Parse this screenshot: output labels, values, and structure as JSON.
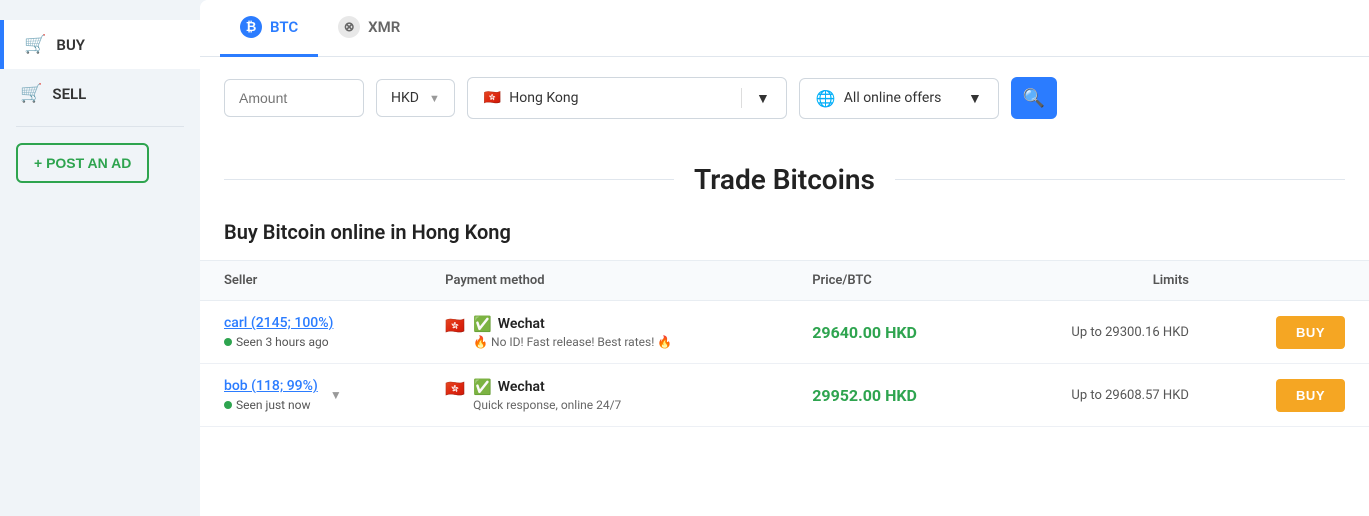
{
  "sidebar": {
    "items": [
      {
        "id": "buy",
        "label": "BUY",
        "icon": "🛒",
        "active": true
      },
      {
        "id": "sell",
        "label": "SELL",
        "icon": "🛒",
        "active": false
      }
    ],
    "post_ad_label": "+ POST AN AD"
  },
  "tabs": [
    {
      "id": "btc",
      "label": "BTC",
      "active": true
    },
    {
      "id": "xmr",
      "label": "XMR",
      "active": false
    }
  ],
  "filter": {
    "amount_placeholder": "Amount",
    "currency": "HKD",
    "location_flag": "🇭🇰",
    "location": "Hong Kong",
    "offers_label": "All online offers",
    "search_icon": "🔍"
  },
  "trade_heading": "Trade Bitcoins",
  "section_title": "Buy Bitcoin online in Hong Kong",
  "table": {
    "headers": [
      "Seller",
      "Payment method",
      "Price/BTC",
      "Limits",
      ""
    ],
    "rows": [
      {
        "seller_name": "carl (2145; 100%)",
        "seen_text": "Seen 3 hours ago",
        "payment_icon": "🇭🇰",
        "payment_check": "✅",
        "payment_name": "Wechat",
        "payment_note": "🔥 No ID! Fast release! Best rates! 🔥",
        "price": "29640.00 HKD",
        "limits": "Up to 29300.16 HKD",
        "buy_label": "BUY",
        "has_expand": false
      },
      {
        "seller_name": "bob (118; 99%)",
        "seen_text": "Seen just now",
        "payment_icon": "🇭🇰",
        "payment_check": "✅",
        "payment_name": "Wechat",
        "payment_note": "Quick response, online 24/7",
        "price": "29952.00 HKD",
        "limits": "Up to 29608.57 HKD",
        "buy_label": "BUY",
        "has_expand": true
      }
    ]
  },
  "colors": {
    "accent_blue": "#2b7cff",
    "accent_green": "#2ea44f",
    "accent_orange": "#f5a623"
  }
}
